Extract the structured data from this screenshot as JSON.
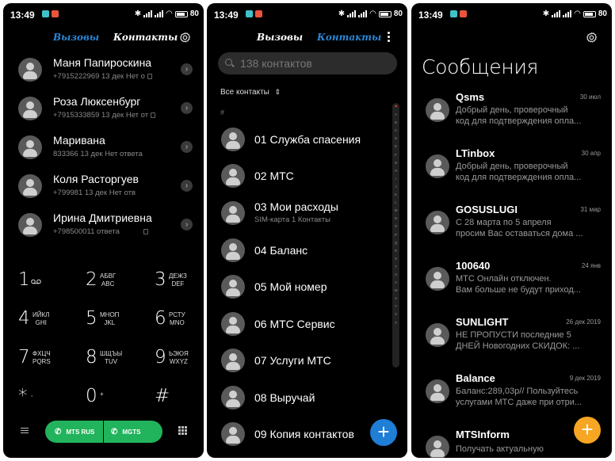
{
  "status": {
    "time": "13:49",
    "battery": "80"
  },
  "dialer": {
    "tabs": {
      "calls": "Вызовы",
      "contacts": "Контакты"
    },
    "calls": [
      {
        "name": "Маня Папироскина",
        "detail": "+7915222969 13 дек Нет о"
      },
      {
        "name": "Роза Люксенбург",
        "detail": "+7915333859 13 дек Нет от"
      },
      {
        "name": "Маривана",
        "detail": "833366 13 дек Нет ответа"
      },
      {
        "name": "Коля Расторгуев",
        "detail": "+799981     13 дек Нет отв"
      },
      {
        "name": "Ирина Дмитриевна",
        "detail": "+798500011   ответа"
      }
    ],
    "keypad": [
      {
        "digit": "1",
        "letters": ""
      },
      {
        "digit": "2",
        "letters": "АБВГ\nABC"
      },
      {
        "digit": "3",
        "letters": "ДЕЖЗ\nDEF"
      },
      {
        "digit": "4",
        "letters": "ИЙКЛ\nGHI"
      },
      {
        "digit": "5",
        "letters": "МНОП\nJKL"
      },
      {
        "digit": "6",
        "letters": "РСТУ\nMNO"
      },
      {
        "digit": "7",
        "letters": "ФХЦЧ\nPQRS"
      },
      {
        "digit": "8",
        "letters": "ШЩЪЫ\nTUV"
      },
      {
        "digit": "9",
        "letters": "ЬЭЮЯ\nWXYZ"
      },
      {
        "digit": "*",
        "letters": ","
      },
      {
        "digit": "0",
        "letters": "+"
      },
      {
        "digit": "#",
        "letters": ""
      }
    ],
    "sim_buttons": {
      "sim1": "MTS RUS",
      "sim2": "MGTS"
    }
  },
  "contacts": {
    "tabs": {
      "calls": "Вызовы",
      "contacts": "Контакты"
    },
    "search_placeholder": "138 контактов",
    "filter_label": "Все контакты",
    "section": "#",
    "items": [
      {
        "name": "01 Служба спасения",
        "sub": ""
      },
      {
        "name": "02 МТС",
        "sub": ""
      },
      {
        "name": "03 Мои расходы",
        "sub": "SIM-карта 1 Контакты"
      },
      {
        "name": "04 Баланс",
        "sub": ""
      },
      {
        "name": "05 Мой номер",
        "sub": ""
      },
      {
        "name": "06 МТС Сервис",
        "sub": ""
      },
      {
        "name": "07 Услуги МТС",
        "sub": ""
      },
      {
        "name": "08 Выручай",
        "sub": ""
      },
      {
        "name": "09 Копия контактов",
        "sub": ""
      }
    ],
    "alphabet": [
      "♥",
      "A",
      "B",
      "C",
      "D",
      "E",
      "F",
      "G",
      "H",
      "I",
      "J",
      "K",
      "L",
      "M",
      "N",
      "O",
      "P",
      "Q",
      "R",
      "S",
      "T",
      "U",
      "V",
      "W",
      "X",
      "Y",
      "Z",
      "#"
    ]
  },
  "messages": {
    "title": "Сообщения",
    "threads": [
      {
        "sender": "Qsms",
        "date": "30 июл",
        "preview": "Добрый день, проверочный\nкод для подтверждения опла..."
      },
      {
        "sender": "LTinbox",
        "date": "30 апр",
        "preview": "Добрый день, проверочный\nкод для подтверждения опла..."
      },
      {
        "sender": "GOSUSLUGI",
        "date": "31 мар",
        "preview": "С 28 марта по 5 апреля\nпросим Вас оставаться дома ..."
      },
      {
        "sender": "100640",
        "date": "24 янв",
        "preview": "МТС Онлайн отключен.\nВам больше не будут приход..."
      },
      {
        "sender": "SUNLIGHT",
        "date": "26 дек 2019",
        "preview": "НЕ ПРОПУСТИ последние 5\nДНЕЙ Новогодних СКИДОК: ..."
      },
      {
        "sender": "Balance",
        "date": "9 дек 2019",
        "preview": "Баланс:289,03р// Пользуйтесь\nуслугами МТС даже при отри..."
      },
      {
        "sender": "MTSInform",
        "date": "4 н",
        "preview": "Получать актуальную"
      }
    ]
  },
  "colors": {
    "accent_blue": "#2a86d8",
    "call_green": "#21b45c",
    "fab_blue": "#1f7ed6",
    "fab_orange": "#f6a623"
  },
  "icons": [
    "gear-icon",
    "more-vert-icon",
    "search-icon",
    "sort-arrows-icon",
    "info-arrow-icon",
    "menu-icon",
    "dialpad-grid-icon",
    "phone-icon",
    "plus-icon",
    "voicemail-icon"
  ]
}
